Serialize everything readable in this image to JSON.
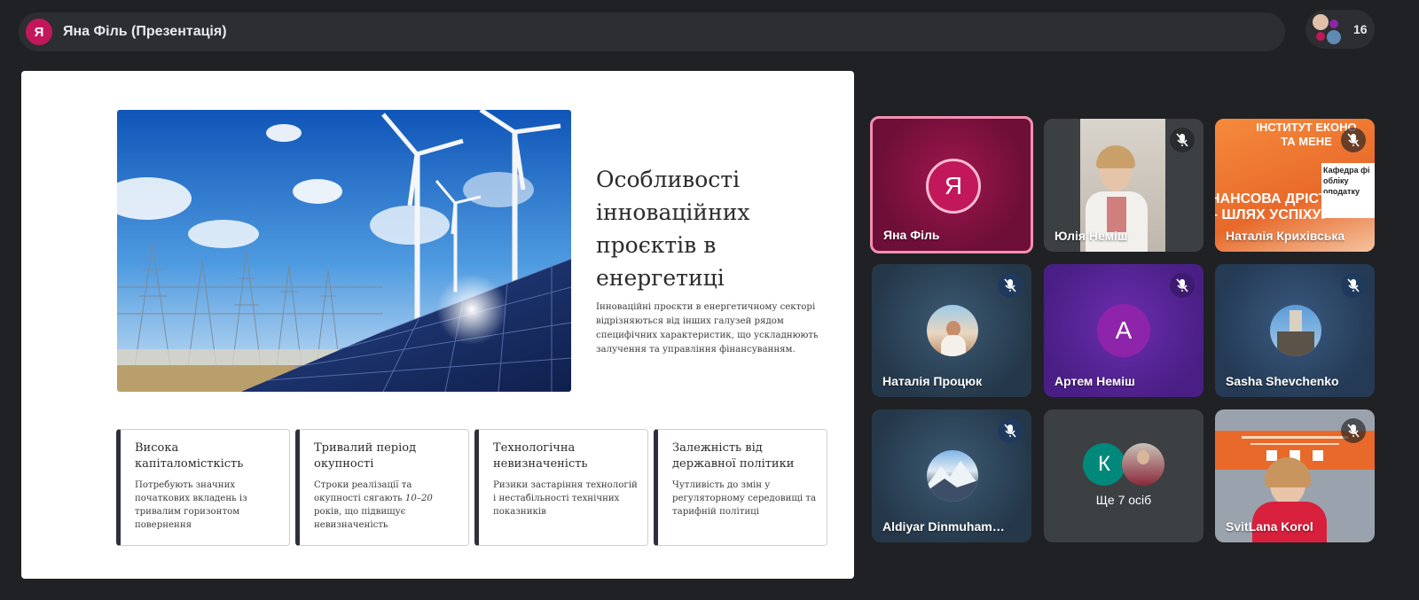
{
  "meeting": {
    "presenter_initial": "Я",
    "title": "Яна Філь (Презентація)",
    "participant_count": "16"
  },
  "slide": {
    "title": "Особливості інноваційних проєктів в енергетиці",
    "subtitle": "Інноваційні проєкти в енергетичному секторі відрізняються від інших галузей рядом специфічних характеристик, що ускладнюють залучення та управління фінансуванням.",
    "cards": [
      {
        "heading": "Висока капіталомісткість",
        "text": "Потребують значних початкових вкладень із тривалим горизонтом повернення"
      },
      {
        "heading": "Тривалий період окупності",
        "text_before": "Строки реалізації та окупності сягають ",
        "text_em": "10–20",
        "text_after": " років, що підвищує невизначеність"
      },
      {
        "heading": "Технологічна невизначеність",
        "text": "Ризики застаріння технологій і нестабільності технічних показників"
      },
      {
        "heading": "Залежність від державної політики",
        "text": "Чутливість до змін у регуляторному середовищі та тарифній політиці"
      }
    ]
  },
  "tiles": [
    {
      "name": "Яна Філь",
      "initial": "Я",
      "color": "#c2185b"
    },
    {
      "name": "Юлія Неміш"
    },
    {
      "name": "Наталія Крихівська",
      "banner_lines": [
        "ІНСТИТУТ ЕКОНО",
        "ТА МЕНЕ"
      ],
      "banner_small": "Кафедра фі обліку оподатку",
      "banner_big": "НАНСОВА ДРІСТЬ – ШЛЯХ УСПІХУ!"
    },
    {
      "name": "Наталія Процюк"
    },
    {
      "name": "Артем Неміш",
      "initial": "А",
      "color": "#8e24aa"
    },
    {
      "name": "Sasha Shevchenko"
    },
    {
      "name": "Aldiyar Dinmuhammed"
    },
    {
      "name": "Ще 7 осіб",
      "initial": "К",
      "color": "#00897b"
    },
    {
      "name": "SvitLana Korol"
    }
  ],
  "colors": {
    "background": "#202124",
    "bar": "#2d2e31",
    "accent_pink": "#c2185b",
    "active_border": "#f48fb1"
  },
  "icons": [
    "mic-off-icon",
    "people-icon"
  ]
}
